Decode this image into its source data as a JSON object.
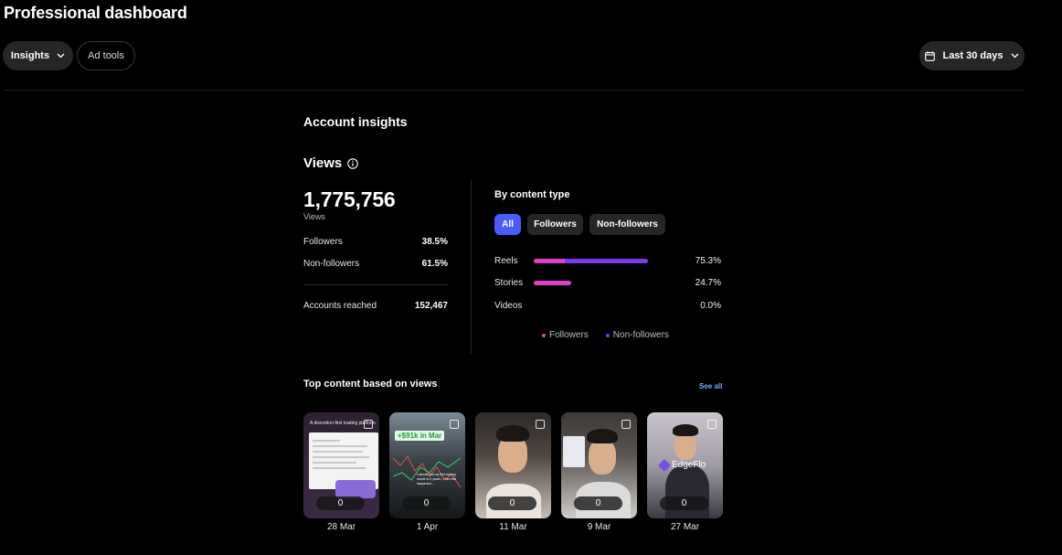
{
  "page": {
    "title": "Professional dashboard"
  },
  "toolbar": {
    "insights_label": "Insights",
    "ad_tools_label": "Ad tools",
    "date_range_label": "Last 30 days"
  },
  "account_insights": {
    "title": "Account insights",
    "views": {
      "label": "Views",
      "total": "1,775,756",
      "total_caption": "Views",
      "followers_label": "Followers",
      "followers_pct": "38.5%",
      "non_followers_label": "Non-followers",
      "non_followers_pct": "61.5%",
      "accounts_reached_label": "Accounts reached",
      "accounts_reached_value": "152,467"
    },
    "by_content_type": {
      "title": "By content type",
      "filters": [
        {
          "label": "All",
          "selected": true
        },
        {
          "label": "Followers",
          "selected": false
        },
        {
          "label": "Non-followers",
          "selected": false
        }
      ],
      "rows": [
        {
          "label": "Reels",
          "pct": "75.3%",
          "value": 75.3,
          "followers_share": 0.275
        },
        {
          "label": "Stories",
          "pct": "24.7%",
          "value": 24.7,
          "followers_share": 1.0
        },
        {
          "label": "Videos",
          "pct": "0.0%",
          "value": 0.0,
          "followers_share": 0
        }
      ],
      "legend": [
        {
          "label": "Followers",
          "color": "#e040c8"
        },
        {
          "label": "Non-followers",
          "color": "#7c3aed"
        }
      ]
    }
  },
  "top_content": {
    "title": "Top content based on views",
    "see_all_label": "See all",
    "items": [
      {
        "date": "28 Mar",
        "views": "0",
        "overlay_text": "A discretion-first trading platform"
      },
      {
        "date": "1 Apr",
        "views": "0",
        "overlay_text": "+$91k in Mar",
        "caption": "I almost lost my first trading month in 2 years.. Then this happened..."
      },
      {
        "date": "11 Mar",
        "views": "0"
      },
      {
        "date": "9 Mar",
        "views": "0"
      },
      {
        "date": "27 Mar",
        "views": "0",
        "overlay_text": "EdgeFlo"
      }
    ]
  },
  "colors": {
    "accent": "#4a5df9",
    "followers": "#e040c8",
    "non_followers": "#7c3aed",
    "link": "#78a8ff"
  }
}
